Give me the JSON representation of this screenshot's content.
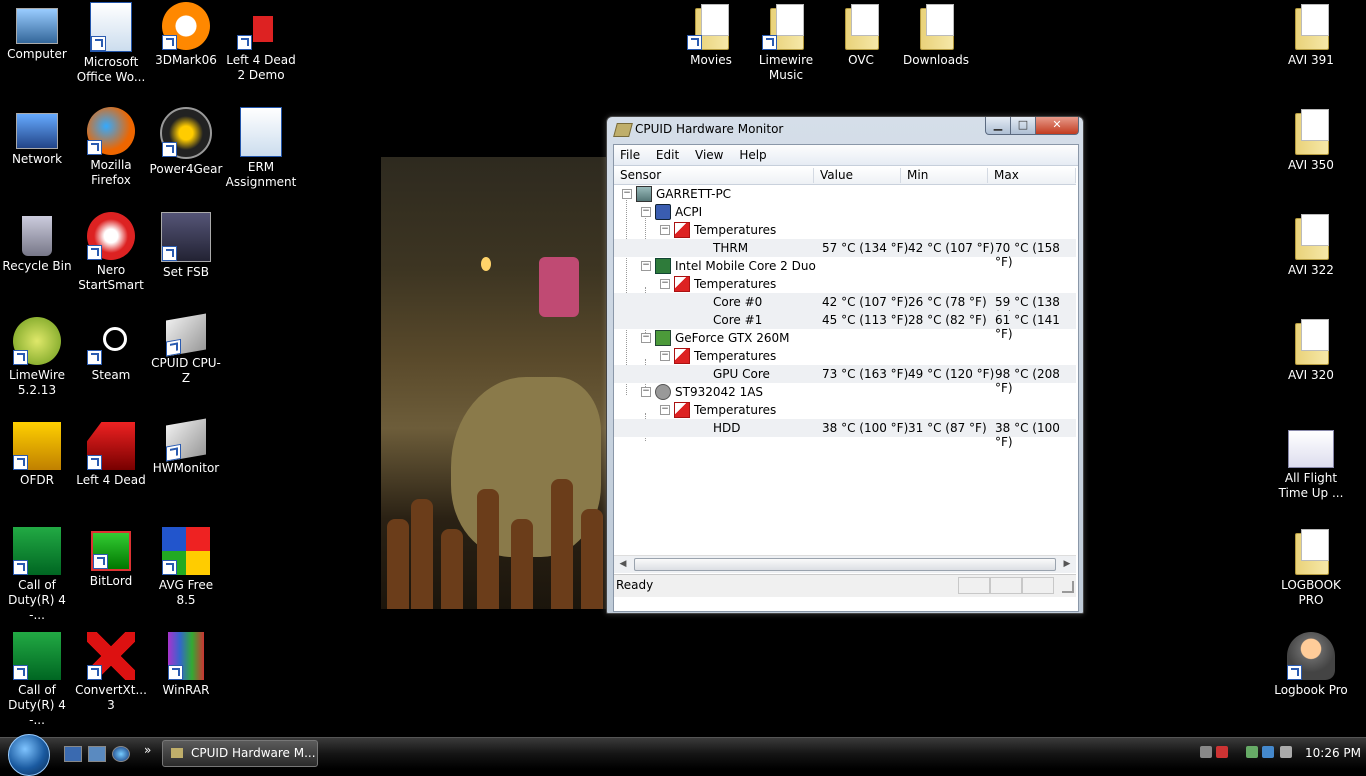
{
  "desktop": {
    "icons_left": [
      {
        "label": "Computer"
      },
      {
        "label": "Microsoft Office Wo..."
      },
      {
        "label": "3DMark06"
      },
      {
        "label": "Left 4 Dead 2 Demo"
      },
      {
        "label": "Network"
      },
      {
        "label": "Mozilla Firefox"
      },
      {
        "label": "Power4Gear"
      },
      {
        "label": "ERM Assignment"
      },
      {
        "label": "Recycle Bin"
      },
      {
        "label": "Nero StartSmart"
      },
      {
        "label": "Set FSB"
      },
      {
        "label": "LimeWire 5.2.13"
      },
      {
        "label": "Steam"
      },
      {
        "label": "CPUID CPU-Z"
      },
      {
        "label": "OFDR"
      },
      {
        "label": "Left 4 Dead"
      },
      {
        "label": "HWMonitor"
      },
      {
        "label": "Call of Duty(R) 4 -..."
      },
      {
        "label": "BitLord"
      },
      {
        "label": "AVG Free 8.5"
      },
      {
        "label": "Call of Duty(R) 4 -..."
      },
      {
        "label": "ConvertXt... 3"
      },
      {
        "label": "WinRAR"
      }
    ],
    "icons_top": [
      {
        "label": "Movies"
      },
      {
        "label": "Limewire Music"
      },
      {
        "label": "OVC"
      },
      {
        "label": "Downloads"
      }
    ],
    "icons_right": [
      {
        "label": "AVI 391"
      },
      {
        "label": "AVI 350"
      },
      {
        "label": "AVI 322"
      },
      {
        "label": "AVI 320"
      },
      {
        "label": "All Flight Time Up ..."
      },
      {
        "label": "LOGBOOK PRO"
      },
      {
        "label": "Logbook Pro"
      }
    ]
  },
  "window": {
    "title": "CPUID Hardware Monitor",
    "menu": [
      "File",
      "Edit",
      "View",
      "Help"
    ],
    "columns": [
      "Sensor",
      "Value",
      "Min",
      "Max"
    ],
    "tree": [
      {
        "name": "GARRETT-PC"
      },
      {
        "name": "ACPI"
      },
      {
        "name": "Temperatures"
      },
      {
        "name": "THRM",
        "value": "57 °C  (134 °F)",
        "min": "42 °C  (107 °F)",
        "max": "70 °C  (158 °F)"
      },
      {
        "name": "Intel Mobile Core 2 Duo"
      },
      {
        "name": "Temperatures"
      },
      {
        "name": "Core #0",
        "value": "42 °C  (107 °F)",
        "min": "26 °C  (78 °F)",
        "max": "59 °C  (138 °F)"
      },
      {
        "name": "Core #1",
        "value": "45 °C  (113 °F)",
        "min": "28 °C  (82 °F)",
        "max": "61 °C  (141 °F)"
      },
      {
        "name": "GeForce GTX 260M"
      },
      {
        "name": "Temperatures"
      },
      {
        "name": "GPU Core",
        "value": "73 °C  (163 °F)",
        "min": "49 °C  (120 °F)",
        "max": "98 °C  (208 °F)"
      },
      {
        "name": "ST932042 1AS"
      },
      {
        "name": "Temperatures"
      },
      {
        "name": "HDD",
        "value": "38 °C  (100 °F)",
        "min": "31 °C  (87 °F)",
        "max": "38 °C  (100 °F)"
      }
    ],
    "status": "Ready"
  },
  "taskbar": {
    "active_task": "CPUID Hardware M...",
    "quicklaunch_more": "»",
    "clock": "10:26 PM"
  }
}
